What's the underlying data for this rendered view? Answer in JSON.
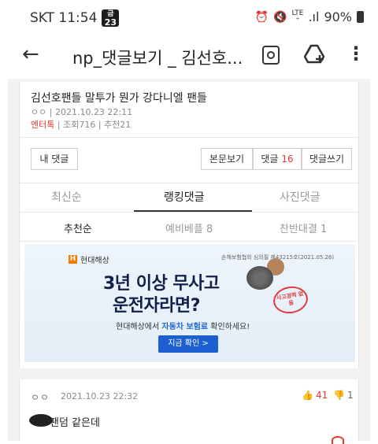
{
  "status_bar": {
    "carrier_time": "SKT 11:54",
    "badge_label": "금",
    "badge_number": "23",
    "lte": "LTE",
    "lte_sub": "⁺",
    "signal": ".ıl",
    "battery": "90%"
  },
  "app_bar": {
    "title": "np_댓글보기 _ 김선호...",
    "icons": [
      "back-arrow-icon",
      "search-page-icon",
      "drive-add-icon",
      "more-vert-icon"
    ]
  },
  "post": {
    "title": "김선호팬들 말투가 뭔가 강다니엘 팬들",
    "author_masked": "ㅇㅇ",
    "datetime": "2021.10.23 22:11",
    "category": "엔터톡",
    "views": "조회716",
    "recommends": "추천21"
  },
  "buttons": {
    "my_comments": "내 댓글",
    "view_body": "본문보기",
    "comments_label": "댓글",
    "comments_count": "16",
    "write_comment": "댓글쓰기"
  },
  "tabs": [
    {
      "label": "최신순",
      "active": false
    },
    {
      "label": "랭킹댓글",
      "active": true
    },
    {
      "label": "사진댓글",
      "active": false
    }
  ],
  "subtabs": [
    {
      "label": "추천순",
      "active": true
    },
    {
      "label": "예비베플 8",
      "active": false
    },
    {
      "label": "찬반대결 1",
      "active": false
    }
  ],
  "ad": {
    "brand": "현대해상",
    "notice": "손해보험협회 심의필 제43215호(2021.05.26)",
    "headline1": "3년 이상 무사고",
    "headline2": "운전자라면?",
    "stamp_text": "사고경력 없음",
    "sub_prefix": "현대해상에서 ",
    "sub_highlight": "자동차 보험료",
    "sub_suffix": " 확인하세요!",
    "cta": "지금 확인 >"
  },
  "comment": {
    "author_masked": "ㅇㅇ",
    "datetime": "2021.10.23 22:32",
    "likes": "41",
    "dislikes": "1",
    "text": "팬덤 같은데"
  },
  "colors": {
    "accent_red": "#e63b2e",
    "ad_blue": "#1d5fd1",
    "ad_navy": "#13204a"
  }
}
